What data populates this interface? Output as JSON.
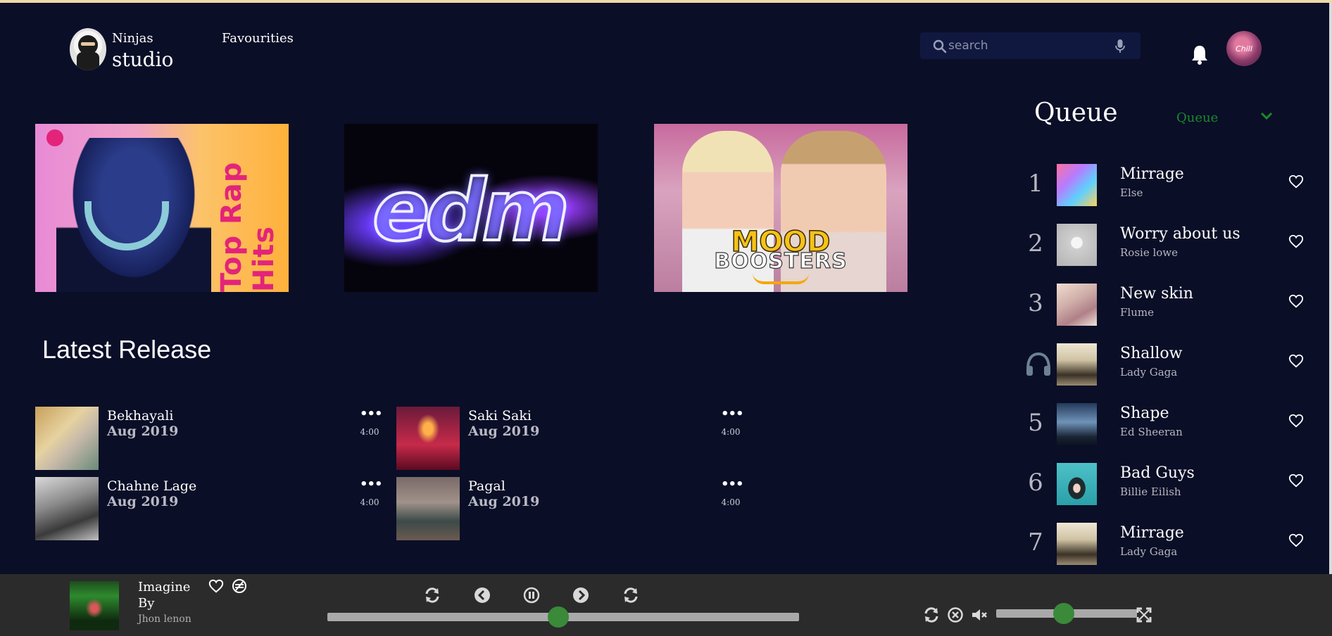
{
  "header": {
    "brand_top": "Ninjas",
    "brand_main": "studio",
    "nav_favourites": "Favourities",
    "search_placeholder": "search",
    "avatar_text": "Chill"
  },
  "banners": [
    {
      "text": "Top Rap Hits"
    },
    {
      "text": "edm"
    },
    {
      "line1": "MOOD",
      "line2": "BOOSTERS"
    }
  ],
  "latest": {
    "title": "Latest Release",
    "items": [
      {
        "name": "Bekhayali",
        "date": "Aug 2019",
        "more": "•••",
        "duration": "4:00"
      },
      {
        "name": "Saki Saki",
        "date": "Aug 2019",
        "more": "•••",
        "duration": "4:00"
      },
      {
        "name": "Chahne Lage",
        "date": "Aug 2019",
        "more": "•••",
        "duration": "4:00"
      },
      {
        "name": "Pagal",
        "date": "Aug 2019",
        "more": "•••",
        "duration": "4:00"
      }
    ]
  },
  "queue": {
    "title": "Queue",
    "select_label": "Queue",
    "items": [
      {
        "num": "1",
        "title": "Mirrage",
        "artist": "Else",
        "playing": false
      },
      {
        "num": "2",
        "title": "Worry about us",
        "artist": "Rosie lowe",
        "playing": false
      },
      {
        "num": "3",
        "title": "New skin",
        "artist": "Flume",
        "playing": false
      },
      {
        "num": "4",
        "title": "Shallow",
        "artist": "Lady Gaga",
        "playing": true
      },
      {
        "num": "5",
        "title": "Shape",
        "artist": "Ed Sheeran",
        "playing": false
      },
      {
        "num": "6",
        "title": "Bad Guys",
        "artist": "Billie Eilish",
        "playing": false
      },
      {
        "num": "7",
        "title": "Mirrage",
        "artist": "Lady Gaga",
        "playing": false
      }
    ]
  },
  "player": {
    "title": "Imagine",
    "by": "By",
    "artist": "Jhon lenon",
    "progress": 0.49,
    "volume": 0.48
  },
  "colors": {
    "background": "#0a0e27",
    "player_bar": "#2b2b2b",
    "accent_green": "#3a8a3a",
    "queue_select": "#1b8a2a"
  }
}
